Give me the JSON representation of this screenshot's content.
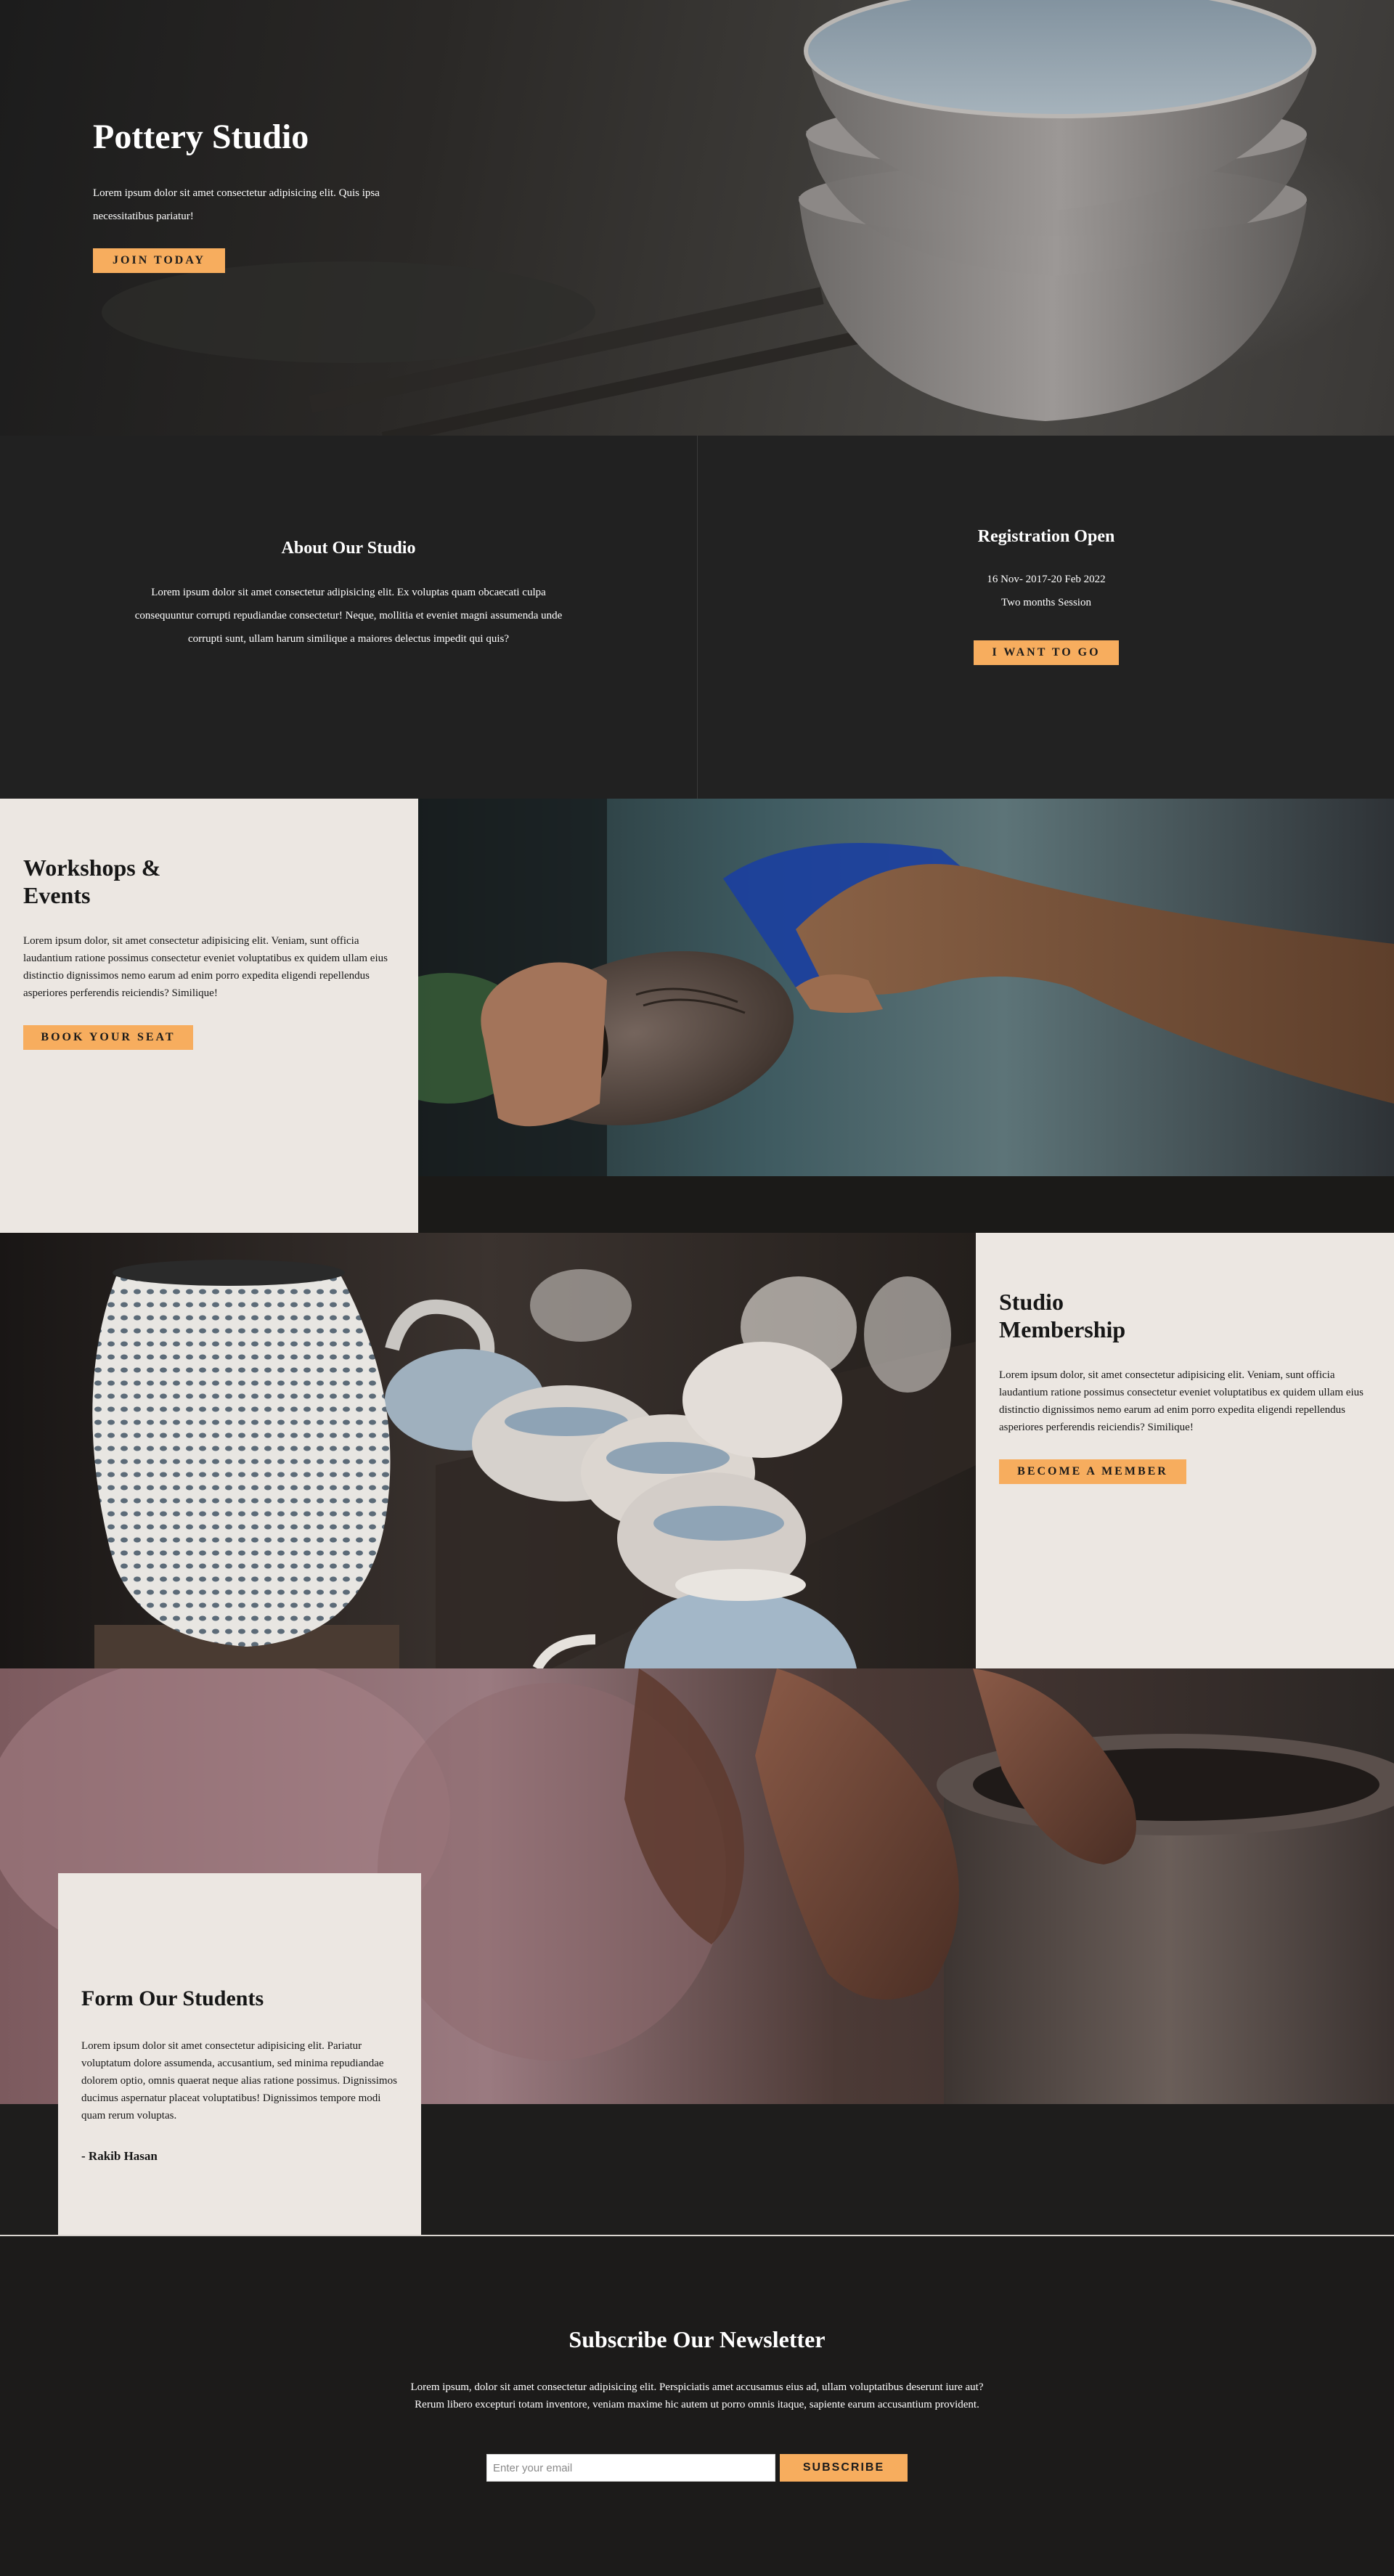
{
  "hero": {
    "title": "Pottery Studio",
    "text": "Lorem ipsum dolor sit amet consectetur adipisicing elit. Quis ipsa necessitatibus pariatur!",
    "button": "JOIN TODAY"
  },
  "about": {
    "title": "About Our Studio",
    "text": "Lorem ipsum dolor sit amet consectetur adipisicing elit. Ex voluptas quam obcaecati culpa consequuntur corrupti repudiandae consectetur! Neque, mollitia et eveniet magni assumenda unde corrupti sunt, ullam harum similique a maiores delectus impedit qui quis?"
  },
  "registration": {
    "title": "Registration Open",
    "dates": "16 Nov- 2017-20 Feb 2022",
    "session": "Two months Session",
    "button": "I WANT TO GO"
  },
  "workshops": {
    "title": "Workshops & Events",
    "text": "Lorem ipsum dolor, sit amet consectetur adipisicing elit. Veniam, sunt officia laudantium ratione possimus consectetur eveniet voluptatibus ex quidem ullam eius distinctio dignissimos nemo earum ad enim porro expedita eligendi repellendus asperiores perferendis reiciendis? Similique!",
    "button": "BOOK YOUR SEAT"
  },
  "membership": {
    "title": "Studio Membership",
    "text": "Lorem ipsum dolor, sit amet consectetur adipisicing elit. Veniam, sunt officia laudantium ratione possimus consectetur eveniet voluptatibus ex quidem ullam eius distinctio dignissimos nemo earum ad enim porro expedita eligendi repellendus asperiores perferendis reiciendis? Similique!",
    "button": "BECOME A MEMBER"
  },
  "students": {
    "title": "Form Our Students",
    "text": "Lorem ipsum dolor sit amet consectetur adipisicing elit. Pariatur voluptatum dolore assumenda, accusantium, sed minima repudiandae dolorem optio, omnis quaerat neque alias ratione possimus. Dignissimos ducimus aspernatur placeat voluptatibus! Dignissimos tempore modi quam rerum voluptas.",
    "signature": "- Rakib Hasan"
  },
  "newsletter": {
    "title": "Subscribe Our Newsletter",
    "text": "Lorem ipsum, dolor sit amet consectetur adipisicing elit. Perspiciatis amet accusamus eius ad, ullam voluptatibus deserunt iure aut? Rerum libero excepturi totam inventore, veniam maxime hic autem ut porro omnis itaque, sapiente earum accusantium provident.",
    "email_placeholder": "Enter your email",
    "button": "SUBSCRIBE"
  },
  "colors": {
    "accent": "#f7ad5e",
    "dark_bg": "#212121",
    "light_panel": "#ece7e2"
  }
}
